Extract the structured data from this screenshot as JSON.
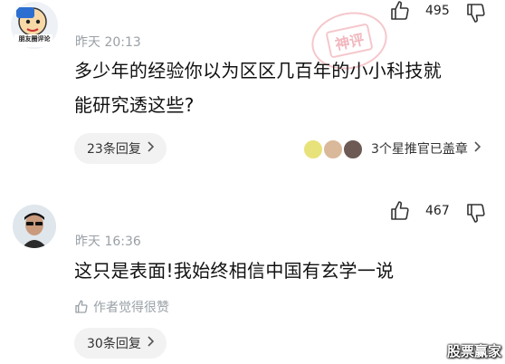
{
  "comments": [
    {
      "time": "昨天 20:13",
      "text_line1": "多少年的经验你以为区区几百年的小小科技就",
      "text_line2": "能研究透这些?",
      "likes": "495",
      "replies_label": "23条回复",
      "recommend_label": "3个星推官已盖章",
      "avatar_caption": "朋友圈评论"
    },
    {
      "time": "昨天 16:36",
      "text_line1": "这只是表面!我始终相信中国有玄学一说",
      "likes": "467",
      "author_liked": "作者觉得很赞",
      "replies_label": "30条回复"
    }
  ],
  "stamp_text": "神评",
  "watermark": "股票赢家",
  "colors": {
    "stamp": "#e15f6e",
    "meta": "#9aa0a6",
    "pill_bg": "#f2f2f2"
  }
}
